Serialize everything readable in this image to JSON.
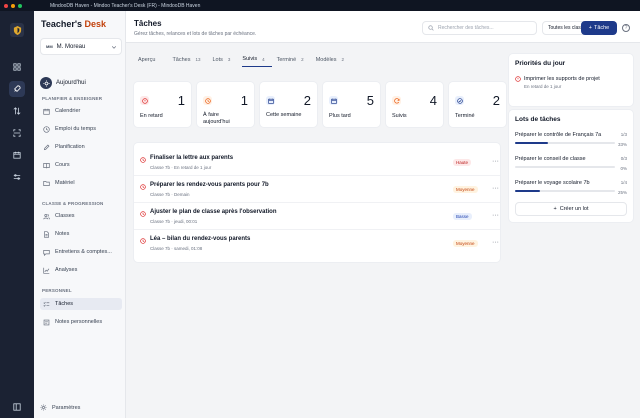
{
  "window": {
    "title": "MindooDB Haven - Mindoo Teacher's Desk (FR) - MindooDB Haven"
  },
  "colors": {
    "accent": "#1e3a8a",
    "danger": "#dc2626",
    "warning": "#ea580c",
    "brand": "#c2410c"
  },
  "brand": {
    "part1": "Teacher's ",
    "part2": "Desk"
  },
  "user": {
    "initials": "MM",
    "name": "M. Moreau"
  },
  "sidebar": {
    "today": "Aujourd'hui",
    "sections": {
      "plan": "PLANIFIER & ENSEIGNER",
      "class": "CLASSE & PROGRESSION",
      "personal": "PERSONNEL"
    },
    "items": [
      {
        "label": "Calendrier",
        "icon": "calendar-icon"
      },
      {
        "label": "Emploi du temps",
        "icon": "clock-icon"
      },
      {
        "label": "Planification",
        "icon": "pencil-icon"
      },
      {
        "label": "Cours",
        "icon": "book-icon"
      },
      {
        "label": "Matériel",
        "icon": "folder-icon"
      },
      {
        "label": "Classes",
        "icon": "users-icon"
      },
      {
        "label": "Notes",
        "icon": "notes-icon"
      },
      {
        "label": "Entretiens & comptes...",
        "icon": "chat-icon"
      },
      {
        "label": "Analyses",
        "icon": "chart-icon"
      },
      {
        "label": "Tâches",
        "icon": "checklist-icon"
      },
      {
        "label": "Notes personnelles",
        "icon": "note-icon"
      }
    ],
    "settings": "Paramètres"
  },
  "header": {
    "title": "Tâches",
    "subtitle": "Gérez tâches, relances et lots de tâches par échéance.",
    "search_placeholder": "Rechercher des tâches...",
    "class_filter": "Toutes les classes",
    "add_label": "Tâche",
    "help": "?"
  },
  "tabs": [
    {
      "label": "Aperçu",
      "count": ""
    },
    {
      "label": "Tâches",
      "count": "13"
    },
    {
      "label": "Lots",
      "count": "3"
    },
    {
      "label": "Suivis",
      "count": "4"
    },
    {
      "label": "Terminé",
      "count": "2"
    },
    {
      "label": "Modèles",
      "count": "2"
    }
  ],
  "active_tab": "Suivis",
  "summary": [
    {
      "label": "En retard",
      "value": "1",
      "icon": "alert-icon",
      "color": "#dc2626",
      "bg": "#fde8e8"
    },
    {
      "label": "À faire aujourd'hui",
      "value": "1",
      "icon": "clock-icon",
      "color": "#ea580c",
      "bg": "#fff1e6"
    },
    {
      "label": "Cette semaine",
      "value": "2",
      "icon": "calendar-icon",
      "color": "#1e3a8a",
      "bg": "#e8effc"
    },
    {
      "label": "Plus tard",
      "value": "5",
      "icon": "calendar-icon",
      "color": "#1e3a8a",
      "bg": "#e8effc"
    },
    {
      "label": "Suivis",
      "value": "4",
      "icon": "refresh-icon",
      "color": "#ea580c",
      "bg": "#fff1e6"
    },
    {
      "label": "Terminé",
      "value": "2",
      "icon": "check-circle-icon",
      "color": "#1e3a8a",
      "bg": "#e8effc"
    }
  ],
  "tasks": [
    {
      "title": "Finaliser la lettre aux parents",
      "meta": "Classe 7b · En retard de 1 jour",
      "priority": "Haute",
      "level": "haute"
    },
    {
      "title": "Préparer les rendez-vous parents pour 7b",
      "meta": "Classe 7b · Demain",
      "priority": "Moyenne",
      "level": "moyenne"
    },
    {
      "title": "Ajuster le plan de classe après l'observation",
      "meta": "Classe 7b · jeudi, 00:01",
      "priority": "Basse",
      "level": "basse"
    },
    {
      "title": "Léa – bilan du rendez-vous parents",
      "meta": "Classe 7b · samedi, 01:08",
      "priority": "Moyenne",
      "level": "moyenne"
    }
  ],
  "priorities": {
    "title": "Priorités du jour",
    "item": {
      "title": "Imprimer les supports de projet",
      "meta": "En retard de 1 jour"
    }
  },
  "lots": {
    "title": "Lots de tâches",
    "items": [
      {
        "title": "Préparer le contrôle de Français 7a",
        "count": "1/3",
        "percent": "33%",
        "fraction": 0.33
      },
      {
        "title": "Préparer le conseil de classe",
        "count": "0/3",
        "percent": "0%",
        "fraction": 0
      },
      {
        "title": "Préparer le voyage scolaire 7b",
        "count": "1/4",
        "percent": "25%",
        "fraction": 0.25
      }
    ],
    "create_label": "Créer un lot"
  }
}
